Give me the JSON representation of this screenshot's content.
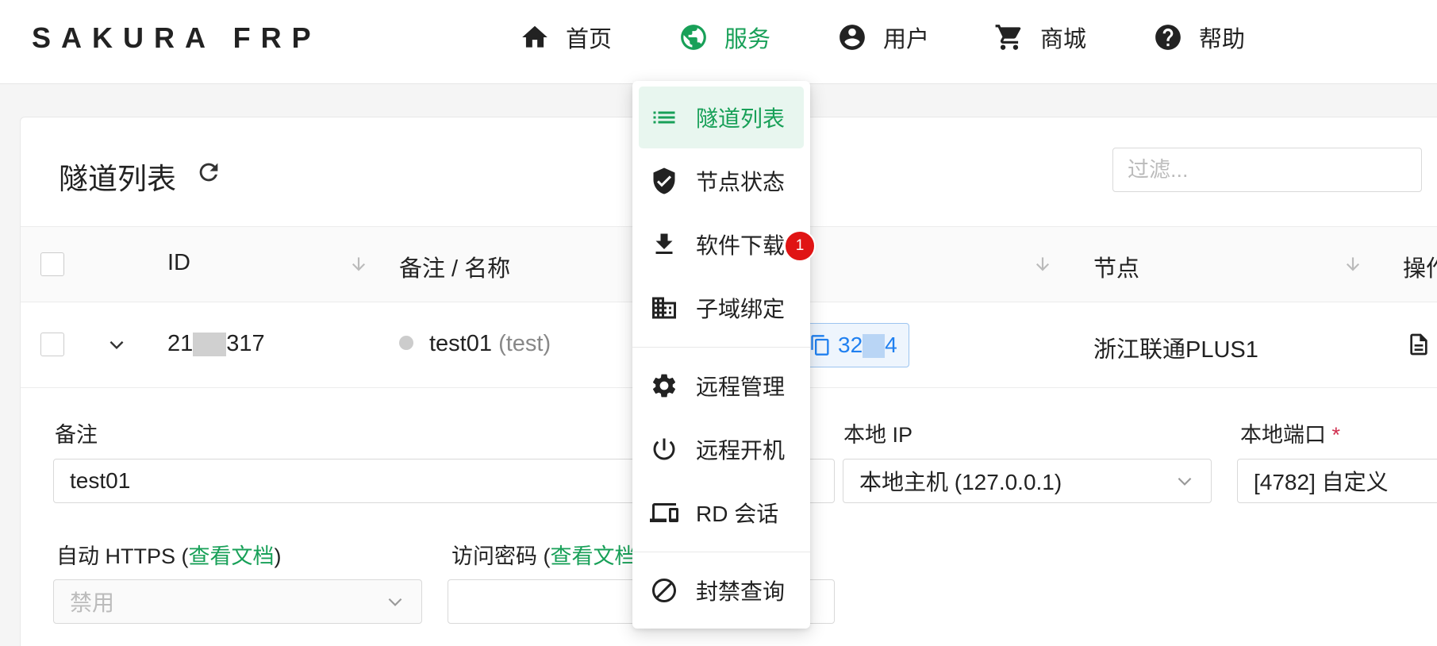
{
  "header": {
    "brand": "SAKURA FRP",
    "nav": [
      {
        "label": "首页",
        "icon": "home-icon"
      },
      {
        "label": "服务",
        "icon": "globe-icon",
        "active": true
      },
      {
        "label": "用户",
        "icon": "account-icon"
      },
      {
        "label": "商城",
        "icon": "cart-icon"
      },
      {
        "label": "帮助",
        "icon": "help-icon"
      }
    ]
  },
  "main": {
    "title": "隧道列表",
    "filter_placeholder": "过滤...",
    "columns": {
      "id": "ID",
      "name": "备注 / 名称",
      "node": "节点",
      "actions": "操作"
    },
    "row": {
      "id_prefix": "21",
      "id_suffix": "317",
      "name": "test01",
      "alias": "(test)",
      "port_prefix": "32",
      "port_suffix": "4",
      "node": "浙江联通PLUS1"
    }
  },
  "form": {
    "remark_label": "备注",
    "remark_value": "test01",
    "local_ip_label": "本地 IP",
    "local_ip_value": "本地主机 (127.0.0.1)",
    "local_port_label": "本地端口",
    "local_port_required": "*",
    "local_port_value": "[4782] 自定义",
    "https_label": "自动 HTTPS (",
    "https_link": "查看文档",
    "https_close": ")",
    "https_value": "禁用",
    "password_label": "访问密码 (",
    "password_link": "查看文档",
    "password_close": ")"
  },
  "dropdown": {
    "items": [
      {
        "label": "隧道列表",
        "icon": "list-icon",
        "active": true
      },
      {
        "label": "节点状态",
        "icon": "shield-check-icon"
      },
      {
        "label": "软件下载",
        "icon": "download-icon",
        "badge": "1"
      },
      {
        "label": "子域绑定",
        "icon": "domain-icon"
      },
      {
        "label": "远程管理",
        "icon": "gear-icon"
      },
      {
        "label": "远程开机",
        "icon": "power-icon"
      },
      {
        "label": "RD 会话",
        "icon": "devices-icon"
      },
      {
        "label": "封禁查询",
        "icon": "block-icon"
      }
    ]
  },
  "colors": {
    "accent": "#18a058",
    "link_blue": "#2080f0",
    "badge_red": "#e01414"
  }
}
